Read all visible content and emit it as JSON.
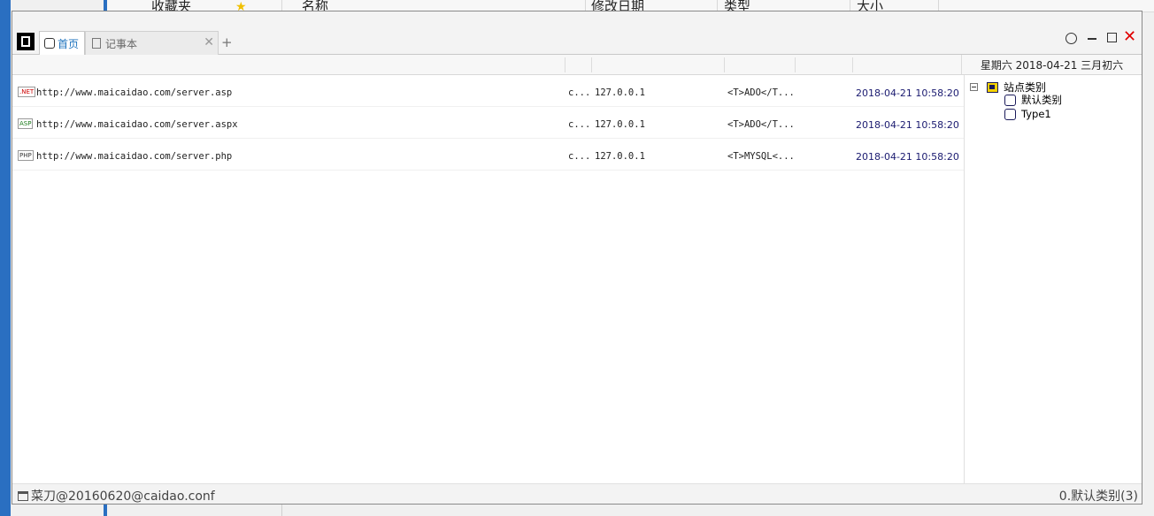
{
  "background_window": {
    "favorites_label": "收藏夹",
    "columns": [
      "名称",
      "修改日期",
      "类型",
      "大小"
    ]
  },
  "tabs": {
    "home": "首页",
    "notepad": "记事本",
    "close_glyph": "✕",
    "add_glyph": "+"
  },
  "window_controls": {
    "close_glyph": "✕"
  },
  "date_header": "星期六 2018-04-21  三月初六",
  "rows": [
    {
      "badge": ".NET",
      "url": "http://www.maicaidao.com/server.asp",
      "c": "c...",
      "ip": "127.0.0.1",
      "type": "<T>ADO</T...",
      "time": "2018-04-21 10:58:20"
    },
    {
      "badge": "ASP",
      "url": "http://www.maicaidao.com/server.aspx",
      "c": "c...",
      "ip": "127.0.0.1",
      "type": "<T>ADO</T...",
      "time": "2018-04-21 10:58:20"
    },
    {
      "badge": "PHP",
      "url": "http://www.maicaidao.com/server.php",
      "c": "c...",
      "ip": "127.0.0.1",
      "type": "<T>MYSQL<...",
      "time": "2018-04-21 10:58:20"
    }
  ],
  "tree": {
    "root": "站点类别",
    "children": [
      "默认类别",
      "Type1"
    ]
  },
  "status": {
    "left": "菜刀@20160620@caidao.conf",
    "right": "0.默认类别(3)"
  },
  "colors": {
    "accent": "#1e73be",
    "close": "#e00000",
    "time_text": "#1a1a70"
  }
}
